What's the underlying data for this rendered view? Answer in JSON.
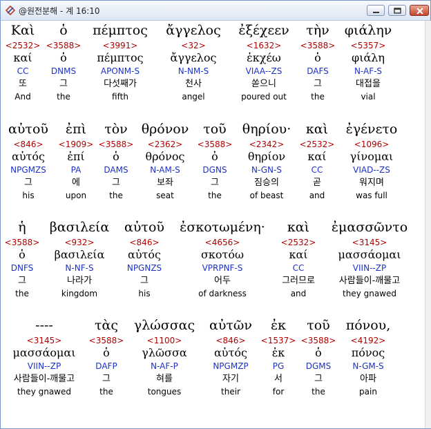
{
  "window": {
    "title": "@원전분해 - 계 16:10",
    "icon": "app-logo-icon",
    "controls": [
      "minimize-icon",
      "maximize-icon",
      "close-icon"
    ]
  },
  "rows": [
    {
      "words": [
        {
          "greek": "Καὶ",
          "strong": "<2532>",
          "lemma": "καί",
          "parsing": "CC",
          "korean": "또",
          "english": "And"
        },
        {
          "greek": "ὁ",
          "strong": "<3588>",
          "lemma": "ὁ",
          "parsing": "DNMS",
          "korean": "그",
          "english": "the"
        },
        {
          "greek": "πέμπτος",
          "strong": "<3991>",
          "lemma": "πέμπτος",
          "parsing": "APONM-S",
          "korean": "다섯째가",
          "english": "fifth"
        },
        {
          "greek": "ἄγγελος",
          "strong": "<32>",
          "lemma": "ἄγγελος",
          "parsing": "N-NM-S",
          "korean": "천사",
          "english": "angel"
        },
        {
          "greek": "ἐξέχεεν",
          "strong": "<1632>",
          "lemma": "ἐκχέω",
          "parsing": "VIAA--ZS",
          "korean": "쏟으니",
          "english": "poured out"
        },
        {
          "greek": "τὴν",
          "strong": "<3588>",
          "lemma": "ὁ",
          "parsing": "DAFS",
          "korean": "그",
          "english": "the"
        },
        {
          "greek": "φιάλην",
          "strong": "<5357>",
          "lemma": "φιάλη",
          "parsing": "N-AF-S",
          "korean": "대접을",
          "english": "vial"
        }
      ]
    },
    {
      "words": [
        {
          "greek": "αὐτοῦ",
          "strong": "<846>",
          "lemma": "αὐτός",
          "parsing": "NPGMZS",
          "korean": "그",
          "english": "his"
        },
        {
          "greek": "ἐπὶ",
          "strong": "<1909>",
          "lemma": "ἐπί",
          "parsing": "PA",
          "korean": "에",
          "english": "upon"
        },
        {
          "greek": "τὸν",
          "strong": "<3588>",
          "lemma": "ὁ",
          "parsing": "DAMS",
          "korean": "그",
          "english": "the"
        },
        {
          "greek": "θρόνον",
          "strong": "<2362>",
          "lemma": "θρόνος",
          "parsing": "N-AM-S",
          "korean": "보좌",
          "english": "seat"
        },
        {
          "greek": "τοῦ",
          "strong": "<3588>",
          "lemma": "ὁ",
          "parsing": "DGNS",
          "korean": "그",
          "english": "the"
        },
        {
          "greek": "θηρίου·",
          "strong": "<2342>",
          "lemma": "θηρίον",
          "parsing": "N-GN-S",
          "korean": "짐승의",
          "english": "of beast"
        },
        {
          "greek": "καὶ",
          "strong": "<2532>",
          "lemma": "καί",
          "parsing": "CC",
          "korean": "곧",
          "english": "and"
        },
        {
          "greek": "ἐγένετο",
          "strong": "<1096>",
          "lemma": "γίνομαι",
          "parsing": "VIAD--ZS",
          "korean": "워지며",
          "english": "was full"
        }
      ]
    },
    {
      "words": [
        {
          "greek": "ἡ",
          "strong": "<3588>",
          "lemma": "ὁ",
          "parsing": "DNFS",
          "korean": "그",
          "english": "the"
        },
        {
          "greek": "βασιλεία",
          "strong": "<932>",
          "lemma": "βασιλεία",
          "parsing": "N-NF-S",
          "korean": "나라가",
          "english": "kingdom"
        },
        {
          "greek": "αὐτοῦ",
          "strong": "<846>",
          "lemma": "αὐτός",
          "parsing": "NPGNZS",
          "korean": "그",
          "english": "his"
        },
        {
          "greek": "ἐσκοτωμένη·",
          "strong": "<4656>",
          "lemma": "σκοτόω",
          "parsing": "VPRPNF-S",
          "korean": "어두",
          "english": "of darkness"
        },
        {
          "greek": "καὶ",
          "strong": "<2532>",
          "lemma": "καί",
          "parsing": "CC",
          "korean": "그러므로",
          "english": "and"
        },
        {
          "greek": "ἐμασσῶντο",
          "strong": "<3145>",
          "lemma": "μασσάομαι",
          "parsing": "VIIN--ZP",
          "korean": "사람들이-깨물고",
          "english": "they gnawed"
        }
      ]
    },
    {
      "words": [
        {
          "greek": "----",
          "strong": "<3145>",
          "lemma": "μασσάομαι",
          "parsing": "VIIN--ZP",
          "korean": "사람들이-깨물고",
          "english": "they gnawed"
        },
        {
          "greek": "τὰς",
          "strong": "<3588>",
          "lemma": "ὁ",
          "parsing": "DAFP",
          "korean": "그",
          "english": "the"
        },
        {
          "greek": "γλώσσας",
          "strong": "<1100>",
          "lemma": "γλῶσσα",
          "parsing": "N-AF-P",
          "korean": "혀를",
          "english": "tongues"
        },
        {
          "greek": "αὐτῶν",
          "strong": "<846>",
          "lemma": "αὐτός",
          "parsing": "NPGMZP",
          "korean": "자기",
          "english": "their"
        },
        {
          "greek": "ἐκ",
          "strong": "<1537>",
          "lemma": "ἐκ",
          "parsing": "PG",
          "korean": "서",
          "english": "for"
        },
        {
          "greek": "τοῦ",
          "strong": "<3588>",
          "lemma": "ὁ",
          "parsing": "DGMS",
          "korean": "그",
          "english": "the"
        },
        {
          "greek": "πόνου,",
          "strong": "<4192>",
          "lemma": "πόνος",
          "parsing": "N-GM-S",
          "korean": "아파",
          "english": "pain"
        }
      ]
    }
  ]
}
